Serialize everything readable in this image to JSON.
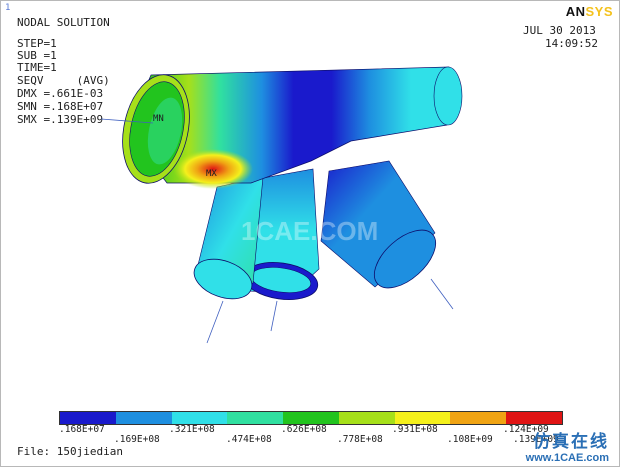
{
  "window_number": "1",
  "header": {
    "title": "NODAL SOLUTION",
    "step": "STEP=1",
    "sub": "SUB =1",
    "time": "TIME=1",
    "result": "SEQV     (AVG)",
    "dmx": "DMX =.661E-03",
    "smn": "SMN =.168E+07",
    "smx": "SMX =.139E+09"
  },
  "logo": {
    "part1": "AN",
    "part2": "SYS"
  },
  "date": "JUL 30 2013",
  "clock": "14:09:52",
  "markers": {
    "min": "MN",
    "max": "MX"
  },
  "watermark_center": "1CAE.COM",
  "legend": {
    "colors": [
      "#1a1acc",
      "#1e8fe0",
      "#30e0e8",
      "#30e0a0",
      "#22c41e",
      "#a6e01a",
      "#f4f01c",
      "#f0a414",
      "#e01414"
    ],
    "labels_top": [
      ".168E+07",
      ".321E+08",
      ".626E+08",
      ".931E+08",
      ".124E+09"
    ],
    "labels_bottom": [
      ".169E+08",
      ".474E+08",
      ".778E+08",
      ".108E+09",
      ".139E+09"
    ]
  },
  "file_label": "File: 150jiedian",
  "watermark": {
    "chinese": "仿真在线",
    "url": "www.1CAE.com"
  }
}
